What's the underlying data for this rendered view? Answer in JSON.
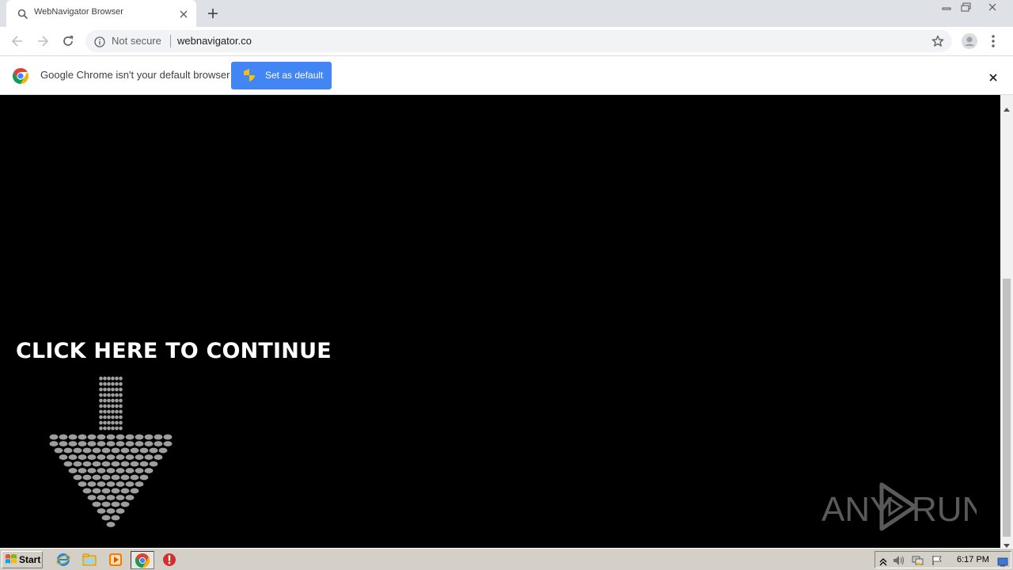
{
  "browser": {
    "tab": {
      "title": "WebNavigator Browser"
    },
    "omnibox": {
      "security_label": "Not secure",
      "url": "webnavigator.co"
    },
    "infobar": {
      "message": "Google Chrome isn't your default browser",
      "button_label": "Set as default"
    }
  },
  "page": {
    "cta_text": "CLICK HERE TO CONTINUE",
    "watermark": {
      "left": "ANY",
      "right": "RUN"
    }
  },
  "taskbar": {
    "start_label": "Start",
    "clock": "6:17 PM"
  },
  "colors": {
    "accent_blue": "#4285f4",
    "tabstrip": "#dee1e6",
    "page_bg": "#000000",
    "arrow_dots": "#9e9e9e"
  },
  "icons": [
    "search-icon",
    "close-icon",
    "plus-icon",
    "back-icon",
    "forward-icon",
    "reload-icon",
    "info-icon",
    "star-icon",
    "profile-icon",
    "more-icon",
    "chrome-logo-icon",
    "shield-icon",
    "arrow-down-icon",
    "windows-logo-icon",
    "ie-icon",
    "folder-icon",
    "media-player-icon",
    "chrome-icon",
    "stop-icon"
  ]
}
